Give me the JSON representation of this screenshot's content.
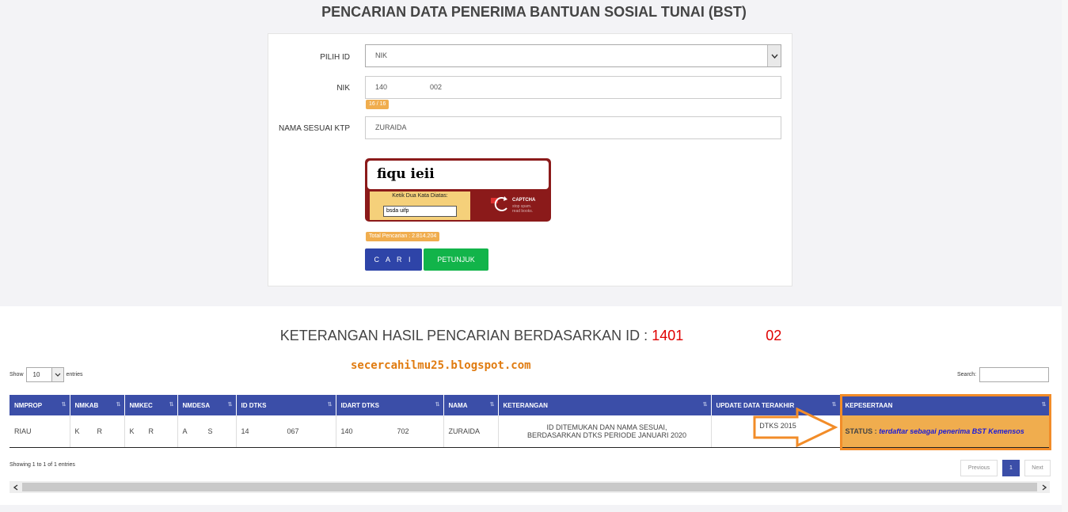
{
  "page": {
    "title": "PENCARIAN DATA PENERIMA BANTUAN SOSIAL TUNAI (BST)"
  },
  "form": {
    "pilih_id_label": "PILIH ID",
    "pilih_id_value": "NIK",
    "nik_label": "NIK",
    "nik_prefix": "140",
    "nik_suffix": "002",
    "nik_counter": "16 / 16",
    "nama_label": "NAMA SESUAI KTP",
    "nama_value": "ZURAIDA",
    "captcha_word": "fiqu  ieii",
    "captcha_prompt": "Ketik Dua Kata Diatas:",
    "captcha_input": "bsda uifp",
    "captcha_brand": "CAPTCHA",
    "captcha_tag_1": "stop spam.",
    "captcha_tag_2": "read books.",
    "total_pencarian": "Total Pencarian : 2.814.204",
    "btn_cari": "C A R I",
    "btn_petunjuk": "PETUNJUK"
  },
  "results": {
    "title_text": "KETERANGAN HASIL PENCARIAN BERDASARKAN ID :",
    "id_prefix": "1401",
    "id_suffix": "02",
    "show_label": "Show",
    "show_value": "10",
    "entries_label": "entries",
    "search_label": "Search:",
    "watermark": "secercahilmu25.blogspot.com",
    "columns": [
      "NMPROP",
      "NMKAB",
      "NMKEC",
      "NMDESA",
      "ID DTKS",
      "IDART DTKS",
      "NAMA",
      "KETERANGAN",
      "UPDATE DATA TERAKHIR",
      "KEPESERTAAN"
    ],
    "row": {
      "nmprop": "RIAU",
      "nmkab_a": "K",
      "nmkab_b": "R",
      "nmkec_a": "K",
      "nmkec_b": "R",
      "nmdesa_a": "A",
      "nmdesa_b": "S",
      "id_dtks_a": "14",
      "id_dtks_b": "067",
      "idart_a": "140",
      "idart_b": "702",
      "nama": "ZURAIDA",
      "keterangan_1": "ID DITEMUKAN DAN NAMA SESUAI,",
      "keterangan_2": "BERDASARKAN DTKS PERIODE JANUARI 2020",
      "update": "DTKS 2015",
      "status_label": "STATUS :",
      "status_value": "terdaftar sebagai penerima BST Kemensos"
    },
    "info": "Showing 1 to 1 of 1 entries",
    "pg_prev": "Previous",
    "pg_current": "1",
    "pg_next": "Next"
  },
  "colors": {
    "accent": "#3b4ea8",
    "warning": "#f0ad4e",
    "success": "#12b44a",
    "highlight": "#f28c28",
    "id_red": "#e00000"
  }
}
